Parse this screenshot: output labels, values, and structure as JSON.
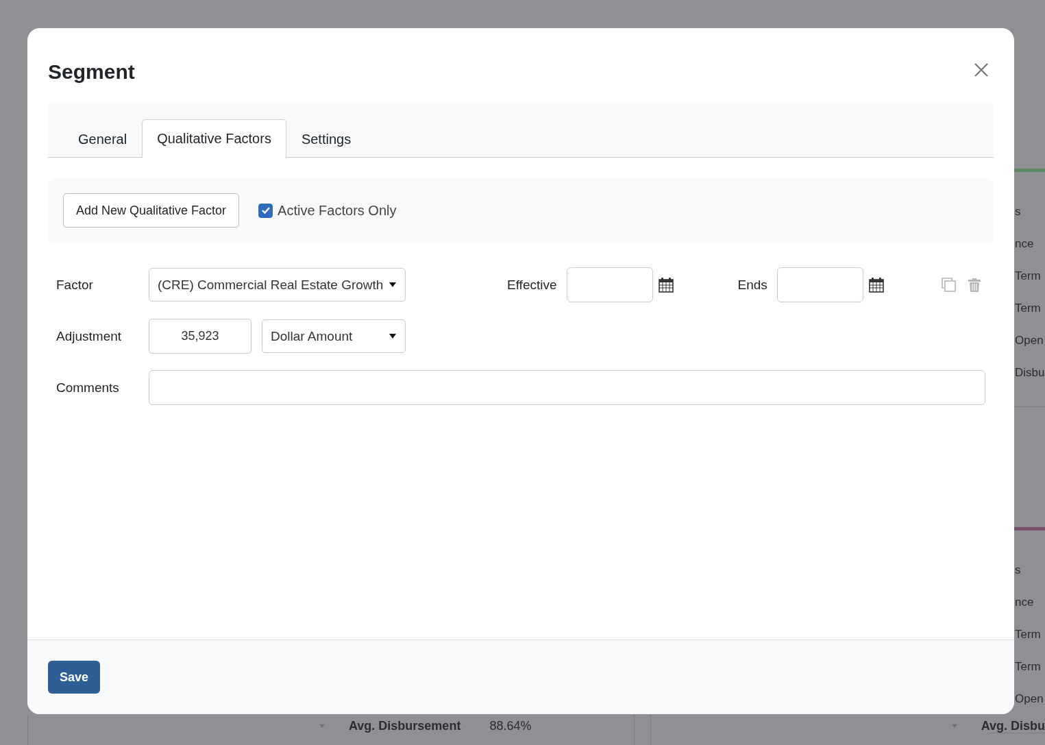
{
  "background": {
    "side_panels": [
      {
        "color": "#5f8a63",
        "labels": [
          "s",
          "nce",
          "Term",
          "Term",
          "Open",
          "Disbu"
        ]
      },
      {
        "color": "#7a4e68",
        "labels": [
          "s",
          "nce",
          "Term",
          "Term",
          "Open"
        ]
      }
    ],
    "bottom_cards": [
      {
        "metric_label": "Avg. Disbursement",
        "metric_value": "88.64%"
      },
      {
        "metric_label": "Avg. Disbu"
      }
    ]
  },
  "dialog": {
    "title": "Segment",
    "tabs": [
      {
        "label": "General",
        "selected": false
      },
      {
        "label": "Qualitative Factors",
        "selected": true
      },
      {
        "label": "Settings",
        "selected": false
      }
    ],
    "add_button": "Add New Qualitative Factor",
    "active_only": {
      "label": "Active Factors Only",
      "checked": true
    },
    "factor": {
      "label": "Factor",
      "value": "(CRE) Commercial Real Estate Growth",
      "effective_label": "Effective",
      "ends_label": "Ends"
    },
    "adjustment": {
      "label": "Adjustment",
      "value": "35,923",
      "type": "Dollar Amount"
    },
    "comments": {
      "label": "Comments"
    },
    "save": "Save"
  }
}
